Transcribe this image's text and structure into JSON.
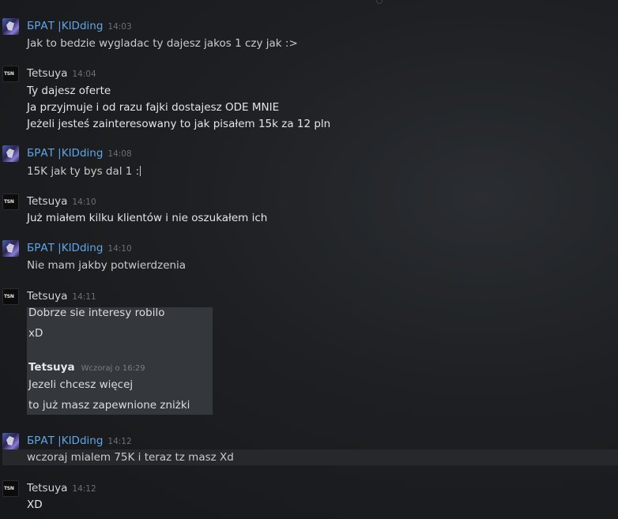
{
  "messages": [
    {
      "author": "БРАТ |KIDding",
      "time": "14:03",
      "lines": [
        "Jak to bedzie wygladac ty dajesz jakos 1 czy jak :>"
      ]
    },
    {
      "author": "Tetsuya",
      "time": "14:04",
      "lines": [
        "Ty dajesz oferte",
        "Ja przyjmuje i od razu fajki dostajesz ODE MNIE",
        "Jeżeli jesteś zainteresowany to jak pisałem 15k za 12 pln"
      ]
    },
    {
      "author": "БРАТ |KIDding",
      "time": "14:08",
      "lines": [
        "15K jak ty bys dal 1 :"
      ]
    },
    {
      "author": "Tetsuya",
      "time": "14:10",
      "lines": [
        "Już miałem kilku klientów i nie oszukałem ich"
      ]
    },
    {
      "author": "БРАТ |KIDding",
      "time": "14:10",
      "lines": [
        "Nie mam jakby potwierdzenia"
      ]
    },
    {
      "author": "Tetsuya",
      "time": "14:11",
      "quote": {
        "lines_top": [
          "Dobrze sie interesy robilo",
          "xD"
        ],
        "author": "Tetsuya",
        "time": "Wczoraj o 16:29",
        "lines_bottom": [
          "Jezeli chcesz więcej",
          "to już masz zapewnione zniżki"
        ]
      }
    },
    {
      "author": "БРАТ |KIDding",
      "time": "14:12",
      "lines": [
        "wczoraj mialem 75K i teraz tz masz Xd"
      ]
    },
    {
      "author": "Tetsuya",
      "time": "14:12",
      "lines": [
        "XD"
      ]
    }
  ],
  "avatars": {
    "brat": "brat-avatar",
    "tetsuya": "tetsuya-avatar",
    "tetsuya_text": "TSN"
  },
  "colors": {
    "background": "#181a1d",
    "brat_name": "#5fa6e6",
    "text": "#c9cacc",
    "quote_bg": "#34373b"
  }
}
